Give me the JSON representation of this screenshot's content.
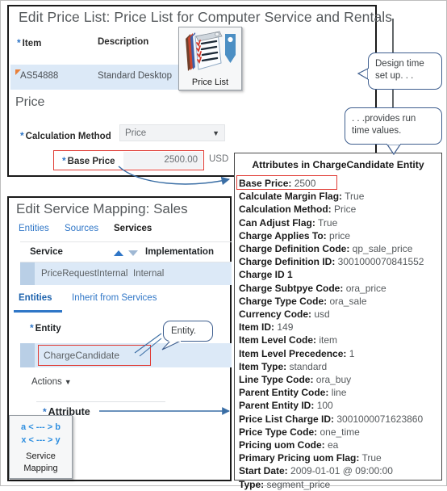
{
  "price_list_panel": {
    "title": "Edit Price List: Price List for Computer Service and Rentals",
    "columns": {
      "item": "Item",
      "description": "Description"
    },
    "row": {
      "item": "AS54888",
      "description": "Standard Desktop"
    },
    "section_title": "Price",
    "calculation_method": {
      "label": "Calculation Method",
      "value": "Price"
    },
    "base_price": {
      "label": "Base Price",
      "value": "2500.00",
      "currency": "USD"
    },
    "required_marker": "*"
  },
  "price_list_icon": {
    "label": "Price List"
  },
  "service_mapping_panel": {
    "title": "Edit Service Mapping: Sales",
    "tabs": [
      {
        "label": "Entities",
        "active": false
      },
      {
        "label": "Sources",
        "active": false
      },
      {
        "label": "Services",
        "active": true
      }
    ],
    "table_headers": {
      "service": "Service",
      "implementation": "Implementation"
    },
    "table_row": {
      "service": "PriceRequestInternal",
      "implementation": "Internal"
    },
    "subtabs": [
      {
        "label": "Entities",
        "active": true
      },
      {
        "label": "Inherit from Services",
        "active": false
      }
    ],
    "entity_label": "Entity",
    "entity_value": "ChargeCandidate",
    "actions_label": "Actions",
    "attribute_label": "Attribute",
    "required_marker": "*"
  },
  "service_mapping_icon": {
    "line1": "a < --- > b",
    "line2": "x < --- > y",
    "label_line1": "Service",
    "label_line2": "Mapping"
  },
  "attributes_panel": {
    "title": "Attributes  in ChargeCandidate Entity",
    "items": [
      {
        "key": "Base Price:",
        "value": "2500"
      },
      {
        "key": "Calculate Margin Flag:",
        "value": "True"
      },
      {
        "key": "Calculation Method:",
        "value": "Price"
      },
      {
        "key": "Can Adjust Flag:",
        "value": "True"
      },
      {
        "key": "Charge Applies To:",
        "value": "price"
      },
      {
        "key": "Charge Definition Code:",
        "value": "qp_sale_price"
      },
      {
        "key": "Charge Definition ID:",
        "value": "3001000070841552"
      },
      {
        "key": "Charge ID 1",
        "value": ""
      },
      {
        "key": "Charge Subtpye Code:",
        "value": "ora_price"
      },
      {
        "key": "Charge Type Code:",
        "value": "ora_sale"
      },
      {
        "key": "Currency Code:",
        "value": "usd"
      },
      {
        "key": "Item ID:",
        "value": "149"
      },
      {
        "key": "Item Level Code:",
        "value": "item"
      },
      {
        "key": "Item Level Precedence:",
        "value": "1"
      },
      {
        "key": "Item Type:",
        "value": "standard"
      },
      {
        "key": "Line Type Code:",
        "value": "ora_buy"
      },
      {
        "key": "Parent Entity  Code:",
        "value": "line"
      },
      {
        "key": "Parent Entity  ID:",
        "value": "100"
      },
      {
        "key": "Price List Charge ID:",
        "value": "3001000071623860"
      },
      {
        "key": "Price Type Code:",
        "value": "one_time"
      },
      {
        "key": "Pricing uom Code:",
        "value": "ea"
      },
      {
        "key": "Primary Pricing uom Flag:",
        "value": "True"
      },
      {
        "key": "Start Date:",
        "value": "2009-01-01  @ 09:00:00"
      },
      {
        "key": "Type:",
        "value": "segment_price"
      }
    ]
  },
  "callouts": {
    "design_time": {
      "line1": "Design time",
      "line2": "set up. . ."
    },
    "run_time": {
      "line1": ". . .provides  run",
      "line2": "time values."
    },
    "entity": {
      "line1": "Entity."
    }
  },
  "colors": {
    "accent_blue": "#2f76c7",
    "highlight_red": "#e03b34",
    "row_blue": "#dce9f7",
    "callout_border": "#3f5f8f",
    "panel_border": "#1a1a1a"
  }
}
